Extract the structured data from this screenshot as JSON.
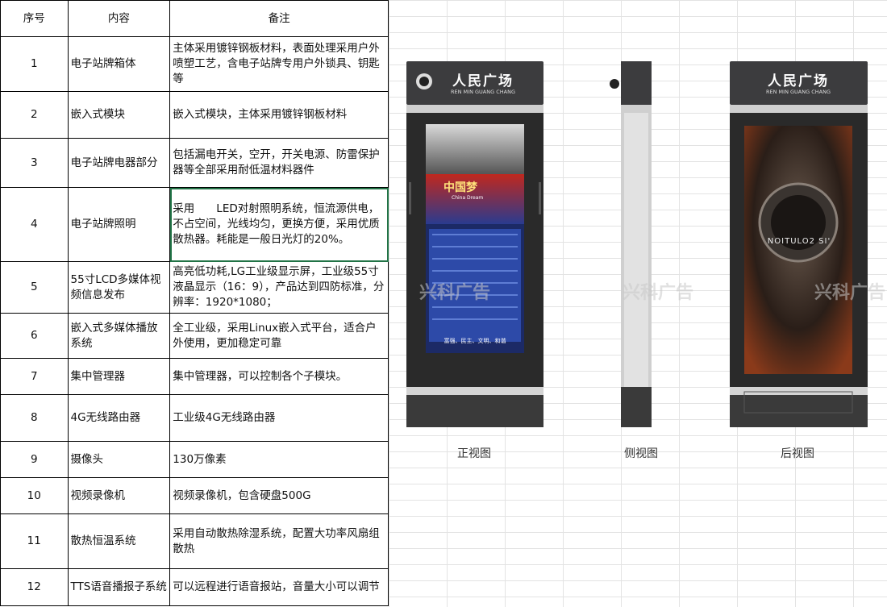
{
  "table": {
    "headers": [
      "序号",
      "内容",
      "备注"
    ],
    "rows": [
      {
        "no": "1",
        "item": "电子站牌箱体",
        "note": "主体采用镀锌钢板材料，表面处理采用户外喷塑工艺，含电子站牌专用户外锁具、钥匙等"
      },
      {
        "no": "2",
        "item": "嵌入式模块",
        "note": "嵌入式模块，主体采用镀锌钢板材料"
      },
      {
        "no": "3",
        "item": "电子站牌电器部分",
        "note": "包括漏电开关，空开，开关电源、防雷保护器等全部采用耐低温材料器件"
      },
      {
        "no": "4",
        "item": "电子站牌照明",
        "note": "采用　　LED对射照明系统，恒流源供电，不占空间，光线均匀，更换方便，采用优质散热器。耗能是一般日光灯的20%。"
      },
      {
        "no": "5",
        "item": "55寸LCD多媒体视频信息发布",
        "note": "高亮低功耗,LG工业级显示屏，工业级55寸液晶显示（16：9），产品达到四防标准，分辨率：1920*1080；"
      },
      {
        "no": "6",
        "item": "嵌入式多媒体播放系统",
        "note": "全工业级，采用Linux嵌入式平台，适合户外使用，更加稳定可靠"
      },
      {
        "no": "7",
        "item": "集中管理器",
        "note": "集中管理器，可以控制各个子模块。"
      },
      {
        "no": "8",
        "item": "4G无线路由器",
        "note": "工业级4G无线路由器"
      },
      {
        "no": "9",
        "item": "摄像头",
        "note": "130万像素"
      },
      {
        "no": "10",
        "item": "视频录像机",
        "note": "视频录像机，包含硬盘500G"
      },
      {
        "no": "11",
        "item": "散热恒温系统",
        "note": "采用自动散热除湿系统，配置大功率风扇组散热"
      },
      {
        "no": "12",
        "item": "TTS语音播报子系统",
        "note": "可以远程进行语音报站，音量大小可以调节"
      }
    ]
  },
  "views": {
    "station_name": "人民广场",
    "station_pinyin": "REN MIN GUANG CHANG",
    "front_caption": "正视图",
    "side_caption": "侧视图",
    "back_caption": "后视图",
    "screen_banner": "中国梦",
    "screen_banner_sub": "China Dream",
    "screen_footer": "富强、民主、文明、和谐",
    "poster_text": "NOITULO2 SI'",
    "watermark": "兴科广告"
  }
}
